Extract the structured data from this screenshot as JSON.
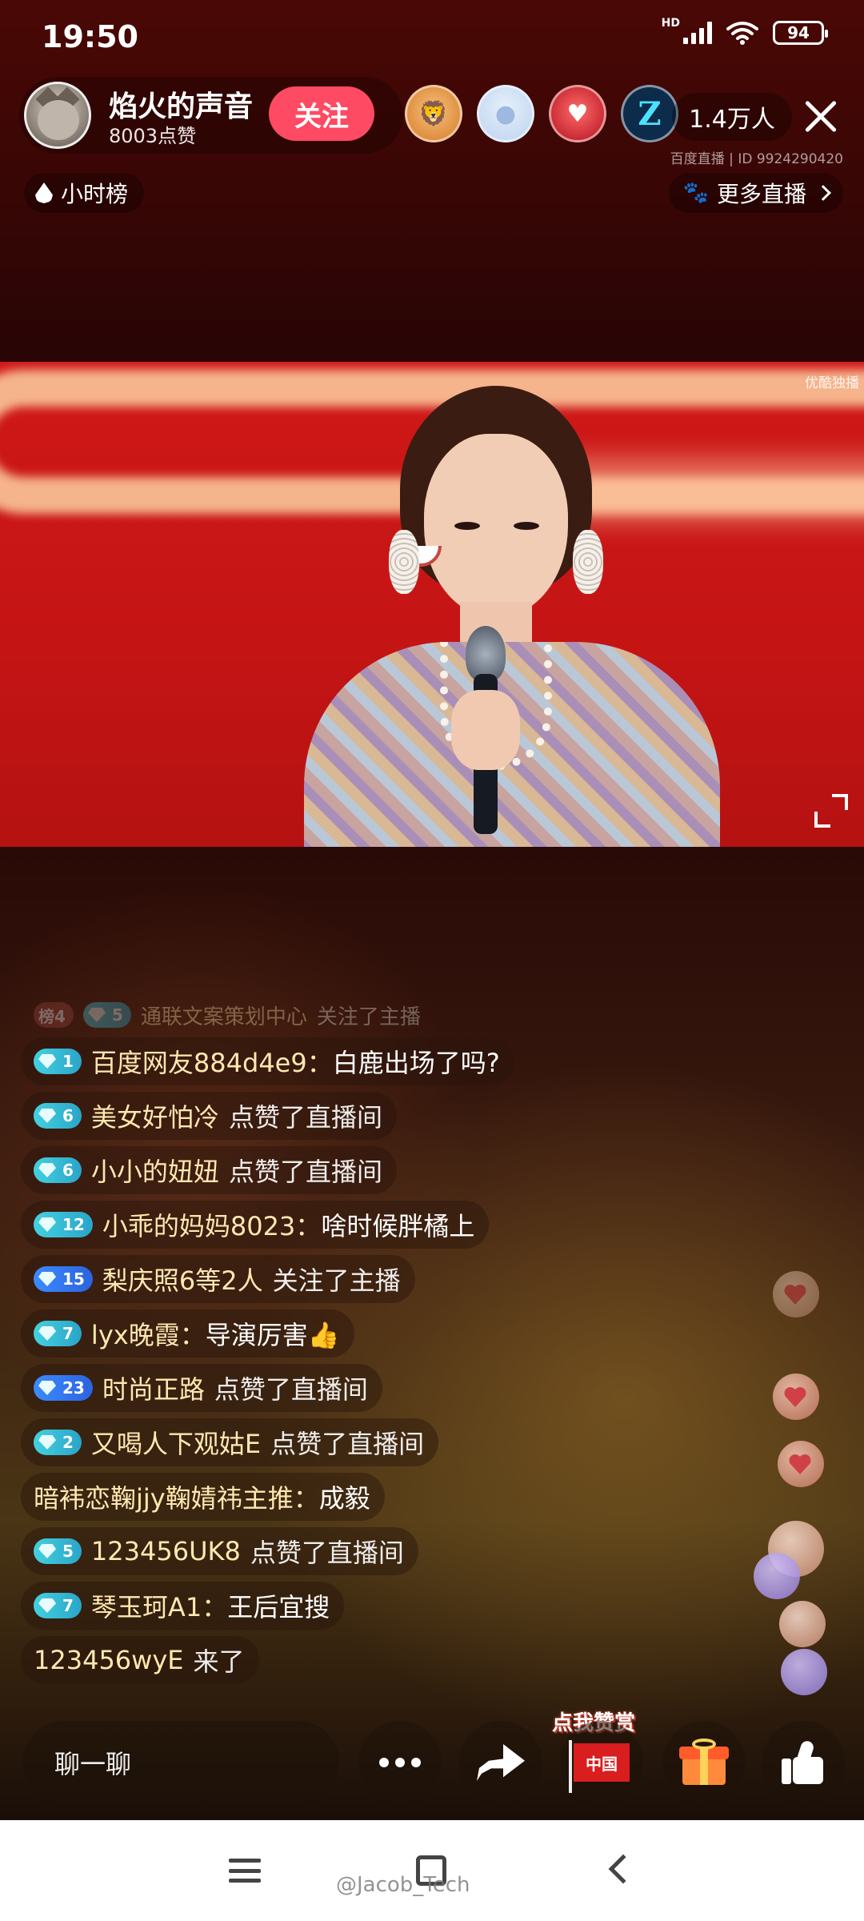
{
  "status_bar": {
    "time": "19:50",
    "network": "HD",
    "battery": "94"
  },
  "streamer": {
    "name": "焰火的声音",
    "likes": "8003点赞",
    "follow_label": "关注"
  },
  "viewers": {
    "avatar_icons": [
      "lion-cub-avatar-icon",
      "default-user-avatar-icon",
      "love-heart-avatar-icon",
      "z-logo-avatar-icon"
    ],
    "z_logo_text": "Z",
    "count": "1.4万人"
  },
  "room": {
    "platform": "百度直播",
    "id_text": "ID 9924290420"
  },
  "rankings": {
    "hour_rank_label": "小时榜",
    "more_live_label": "更多直播"
  },
  "video": {
    "watermark": "优酷独播"
  },
  "chat": {
    "messages": [
      {
        "badge": "5",
        "badge_prefix": "榜4",
        "user": "通联文案策划中心",
        "action": "关注了主播"
      },
      {
        "badge": "1",
        "badge_color": "cyan",
        "user": "百度网友884d4e9",
        "content": "白鹿出场了吗?"
      },
      {
        "badge": "6",
        "badge_color": "cyan",
        "user": "美女好怕冷",
        "action": "点赞了直播间"
      },
      {
        "badge": "6",
        "badge_color": "cyan",
        "user": "小小的妞妞",
        "action": "点赞了直播间"
      },
      {
        "badge": "12",
        "badge_color": "cyan",
        "user": "小乖的妈妈8023",
        "content": "啥时候胖橘上"
      },
      {
        "badge": "15",
        "badge_color": "blue",
        "user": "梨庆照6等2人",
        "action": "关注了主播"
      },
      {
        "badge": "7",
        "badge_color": "cyan",
        "user": "lyx晚霞",
        "content": "导演厉害👍"
      },
      {
        "badge": "23",
        "badge_color": "blue",
        "user": "时尚正路",
        "action": "点赞了直播间"
      },
      {
        "badge": "2",
        "badge_color": "cyan",
        "user": "又喝人下观姑E",
        "action": "点赞了直播间"
      },
      {
        "user": "暗袆恋鞠jjy鞠婧祎主推",
        "content": "成毅"
      },
      {
        "badge": "5",
        "badge_color": "cyan",
        "user": "123456UK8",
        "action": "点赞了直播间"
      },
      {
        "badge": "7",
        "badge_color": "cyan",
        "user": "琴玉珂A1",
        "content": "王后宜搜"
      },
      {
        "user": "123456wyE",
        "action": "来了"
      }
    ],
    "colon": "："
  },
  "bottom_bar": {
    "chat_placeholder": "聊一聊",
    "reward_label": "点我赞赏",
    "flag_text": "中国"
  },
  "watermark": "@Jacob_Tech",
  "colors": {
    "follow_button": "#fe4a62",
    "badge_cyan": "#2aa4c9",
    "badge_blue": "#2b63e0",
    "username": "#ffe8b0"
  }
}
